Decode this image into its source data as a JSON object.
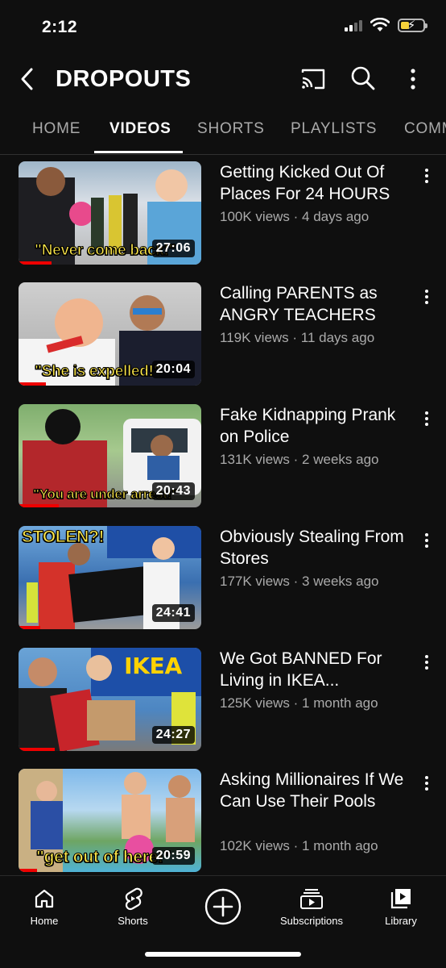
{
  "status_bar": {
    "time": "2:12"
  },
  "header": {
    "title": "DROPOUTS"
  },
  "tabs": [
    {
      "label": "HOME"
    },
    {
      "label": "VIDEOS",
      "active": true
    },
    {
      "label": "SHORTS"
    },
    {
      "label": "PLAYLISTS"
    },
    {
      "label": "COMMUNITY"
    }
  ],
  "videos": [
    {
      "title": "Getting Kicked Out Of Places For 24 HOURS",
      "meta": "100K views · 4 days ago",
      "duration": "27:06",
      "thumb_text": "\"Never come back!\""
    },
    {
      "title": "Calling PARENTS as ANGRY TEACHERS",
      "meta": "119K views · 11 days ago",
      "duration": "20:04",
      "thumb_text": "\"She is expelled!\""
    },
    {
      "title": "Fake Kidnapping Prank on Police",
      "meta": "131K views · 2 weeks ago",
      "duration": "20:43",
      "thumb_text": "\"You are under arrest!\""
    },
    {
      "title": "Obviously Stealing From Stores",
      "meta": "177K views · 3 weeks ago",
      "duration": "24:41",
      "thumb_text": "STOLEN?!"
    },
    {
      "title": "We Got BANNED For Living in IKEA...",
      "meta": "125K views · 1 month ago",
      "duration": "24:27",
      "thumb_text": "IKEA"
    },
    {
      "title": "Asking Millionaires If We Can Use Their Pools",
      "meta": "102K views · 1 month ago",
      "duration": "20:59",
      "thumb_text": "\"get out of here!\""
    }
  ],
  "bottom_nav": {
    "home": "Home",
    "shorts": "Shorts",
    "subscriptions": "Subscriptions",
    "library": "Library"
  },
  "colors": {
    "background": "#0f0f0f",
    "progress": "#ee0000",
    "thumb_text": "#ffe94a"
  }
}
